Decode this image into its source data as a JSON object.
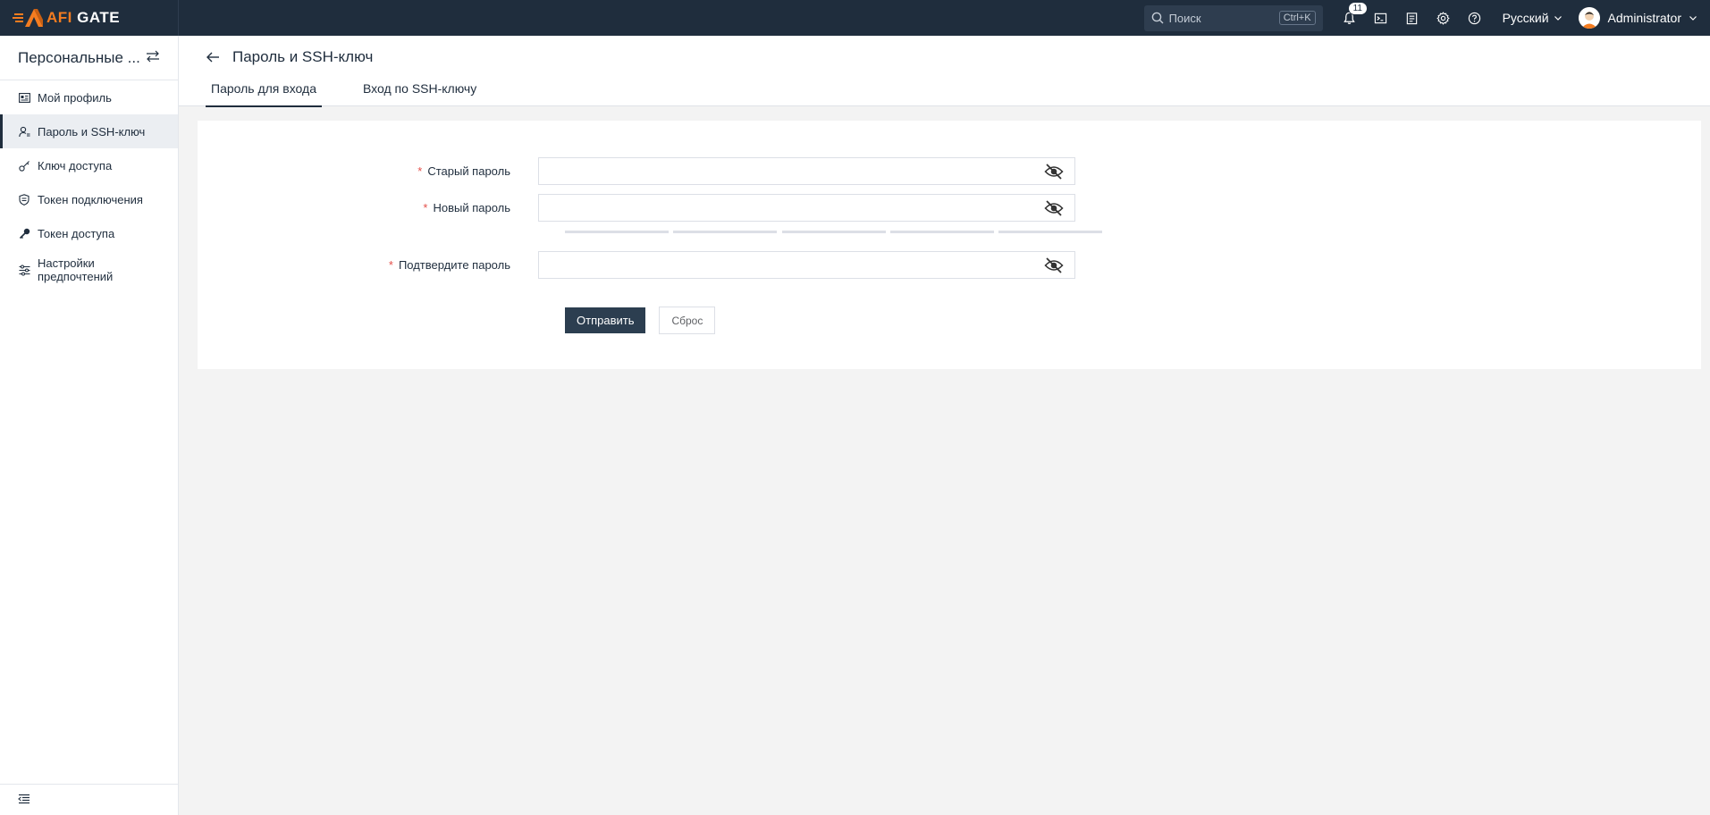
{
  "app": {
    "brand_prefix": "AFI",
    "brand_suffix": " GATE"
  },
  "topbar": {
    "search_placeholder": "Поиск",
    "search_shortcut": "Ctrl+K",
    "notifications_count": "11",
    "language": "Русский",
    "username": "Administrator",
    "icons": [
      "bell-icon",
      "terminal-icon",
      "clipboard-icon",
      "gear-icon",
      "help-icon"
    ]
  },
  "sidebar": {
    "title": "Персональные ...",
    "items": [
      {
        "label": "Мой профиль",
        "icon": "profile-card-icon",
        "active": false
      },
      {
        "label": "Пароль и SSH-ключ",
        "icon": "user-key-icon",
        "active": true
      },
      {
        "label": "Ключ доступа",
        "icon": "key-icon",
        "active": false
      },
      {
        "label": "Токен подключения",
        "icon": "shield-icon",
        "active": false
      },
      {
        "label": "Токен доступа",
        "icon": "key-solid-icon",
        "active": false
      },
      {
        "label": "Настройки предпочтений",
        "icon": "sliders-icon",
        "active": false
      }
    ]
  },
  "main": {
    "title": "Пароль и SSH-ключ",
    "tabs": [
      {
        "label": "Пароль для входа",
        "active": true
      },
      {
        "label": "Вход по SSH-ключу",
        "active": false
      }
    ]
  },
  "form": {
    "old_password_label": "Старый пароль",
    "new_password_label": "Новый пароль",
    "confirm_password_label": "Подтвердите пароль",
    "required_mark": "*",
    "old_password_value": "",
    "new_password_value": "",
    "confirm_password_value": "",
    "submit_label": "Отправить",
    "reset_label": "Сброс"
  },
  "colors": {
    "topbar": "#1f2d3d",
    "brand_accent": "#f47c20",
    "primary_button": "#2c3e50",
    "required": "#e4504a"
  }
}
